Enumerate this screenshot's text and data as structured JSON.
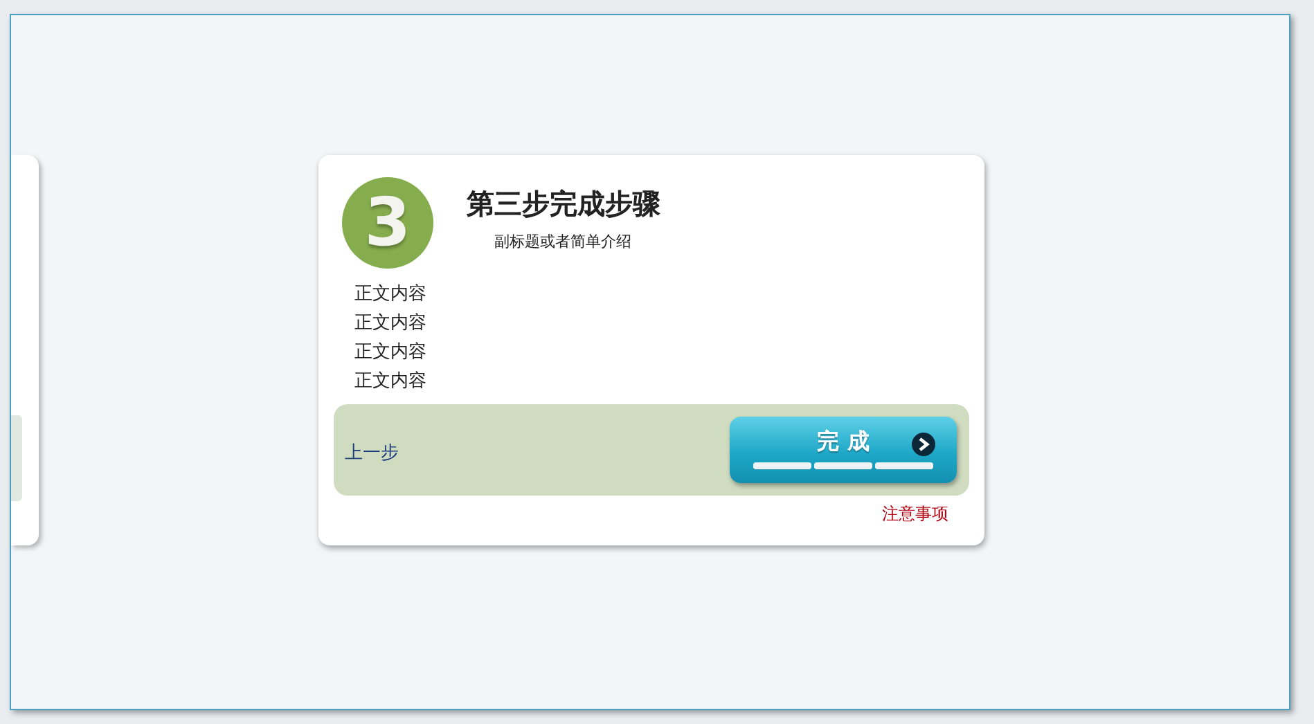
{
  "step": {
    "number": "3",
    "title": "第三步完成步骤",
    "subtitle": "副标题或者简单介绍"
  },
  "body_lines": [
    "正文内容",
    "正文内容",
    "正文内容",
    "正文内容"
  ],
  "footer": {
    "back_link": "上一步",
    "finish_button": "完 成",
    "note_link": "注意事项"
  }
}
